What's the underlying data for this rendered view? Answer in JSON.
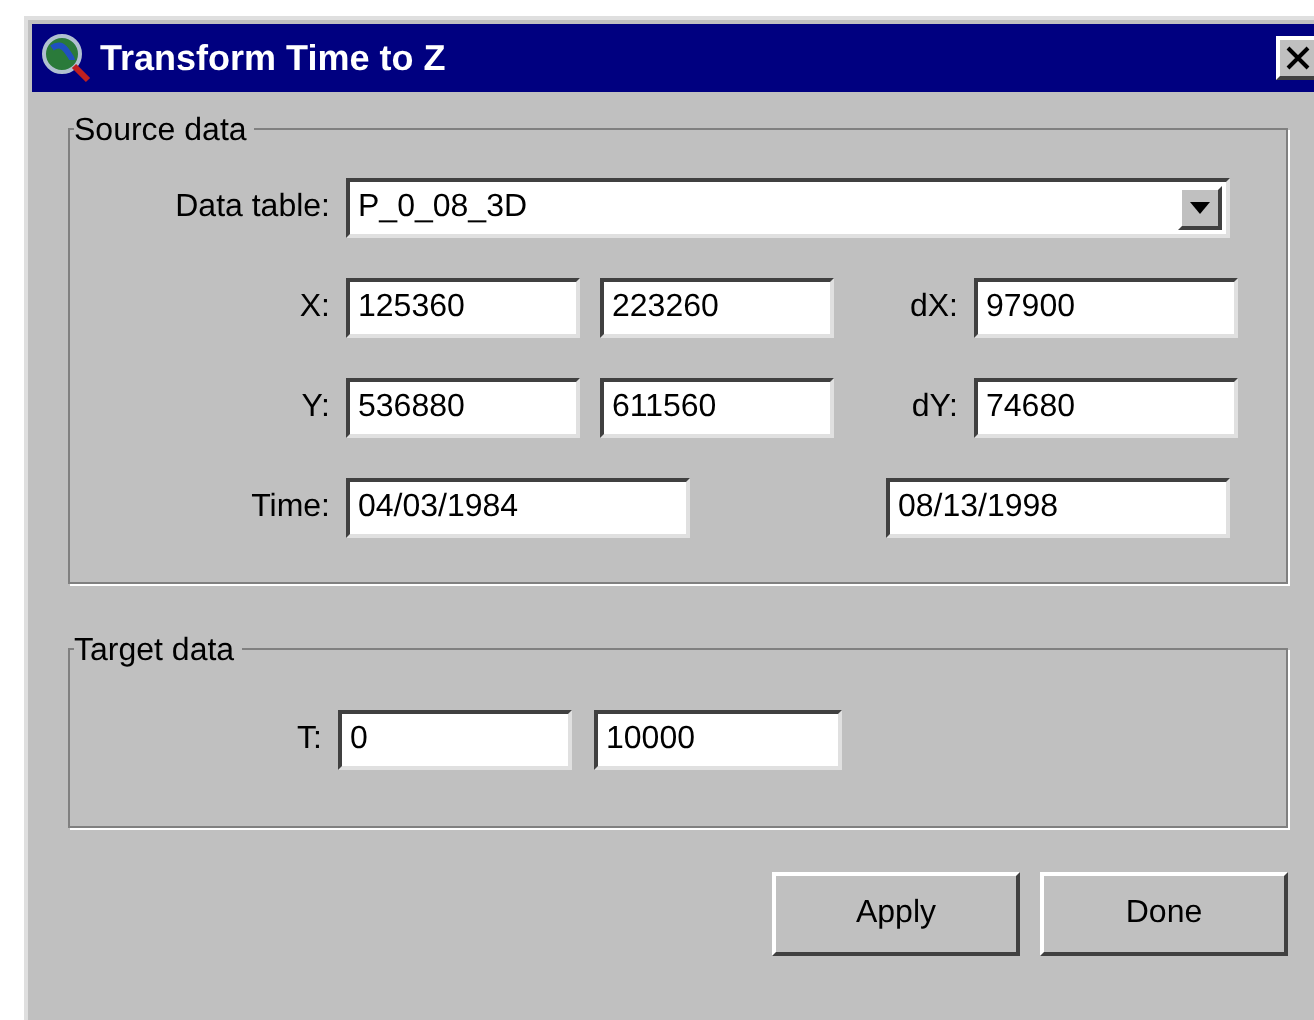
{
  "window": {
    "title": "Transform Time to Z"
  },
  "source": {
    "title": "Source data",
    "table_label": "Data table:",
    "table_value": "P_0_08_3D",
    "rows": [
      {
        "label": "X:",
        "from": "125360",
        "to": "223260",
        "delta_label": "dX:",
        "delta": "97900"
      },
      {
        "label": "Y:",
        "from": "536880",
        "to": "611560",
        "delta_label": "dY:",
        "delta": "74680"
      }
    ],
    "time": {
      "label": "Time:",
      "from": "04/03/1984",
      "to": "08/13/1998"
    }
  },
  "target": {
    "title": "Target data",
    "label": "T:",
    "fields": [
      "0",
      "10000"
    ]
  },
  "buttons": [
    "Apply",
    "Done"
  ]
}
